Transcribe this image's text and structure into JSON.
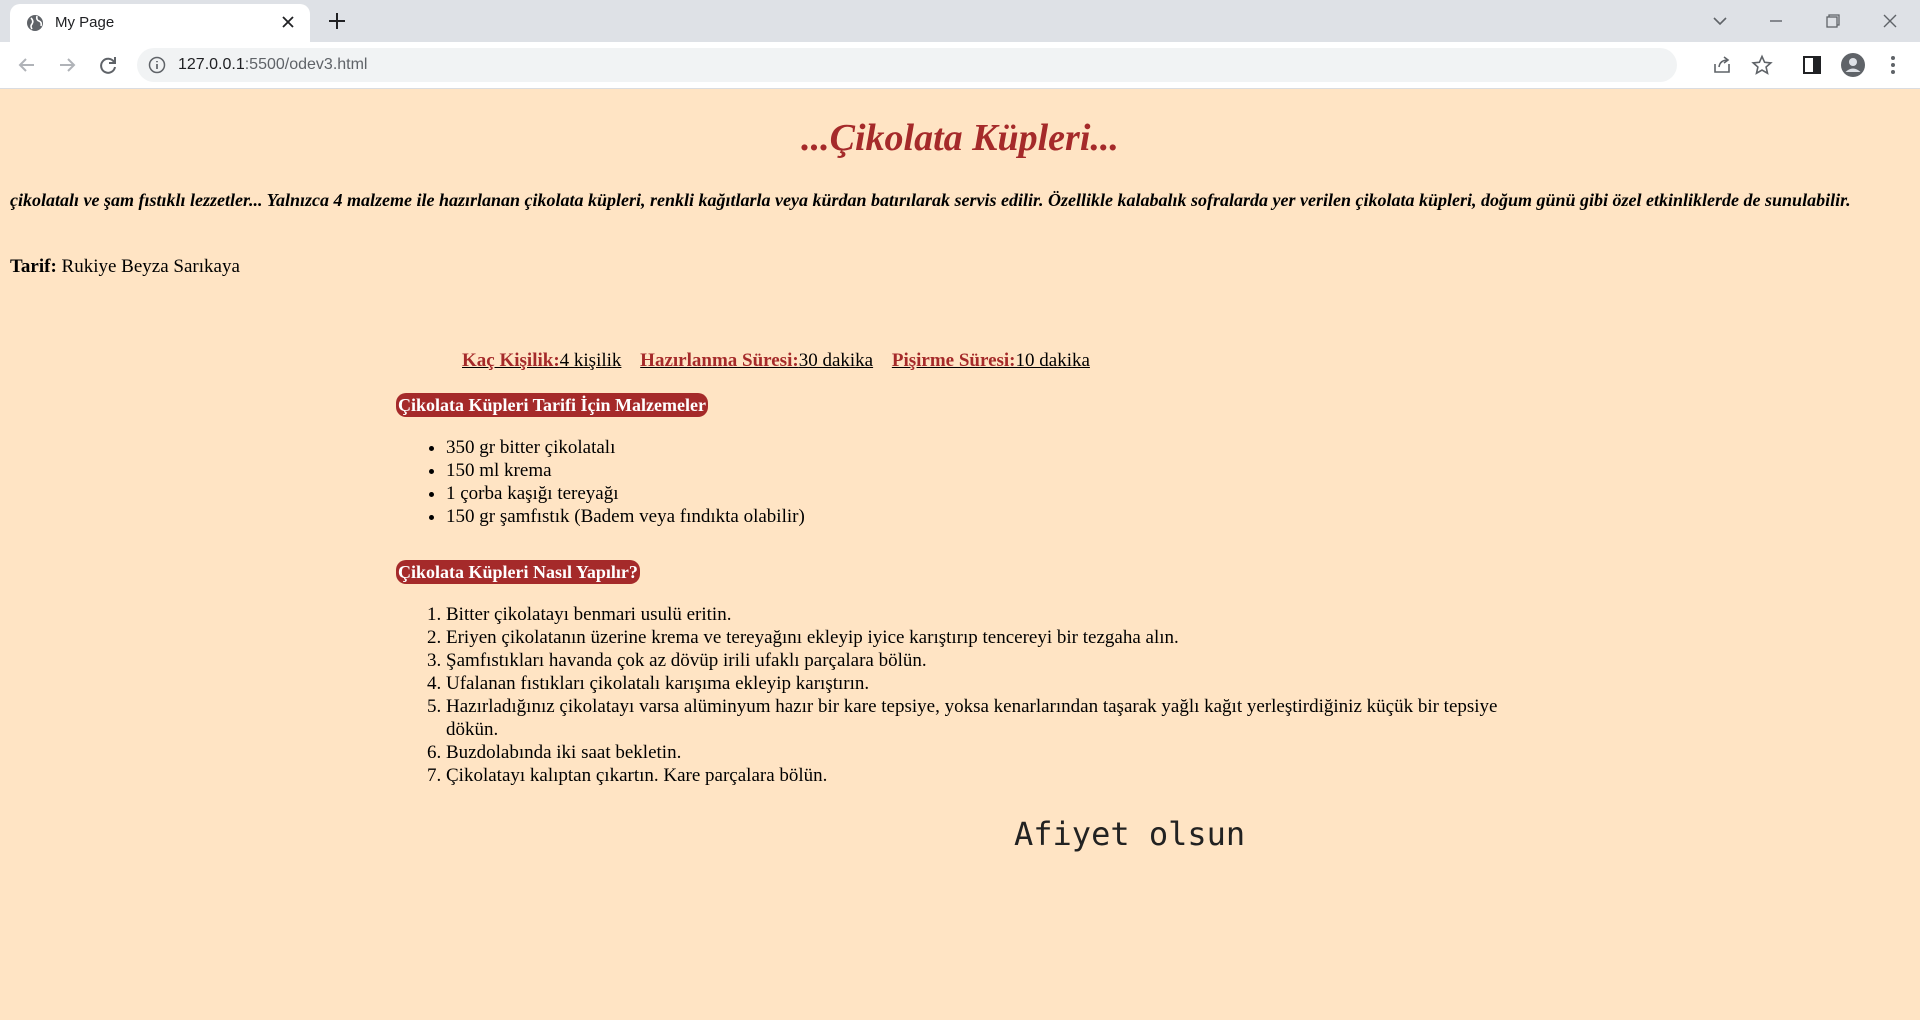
{
  "browser": {
    "tab_title": "My Page",
    "url_host": "127.0.0.1",
    "url_path": ":5500/odev3.html"
  },
  "page": {
    "title": "...Çikolata Küpleri...",
    "intro": "çikolatalı ve şam fıstıklı lezzetler... Yalnızca 4 malzeme ile hazırlanan çikolata küpleri, renkli kağıtlarla veya kürdan batırılarak servis edilir. Özellikle kalabalık sofralarda yer verilen çikolata küpleri, doğum günü gibi özel etkinliklerde de sunulabilir.",
    "author_label": "Tarif:",
    "author_name": "Rukiye Beyza Sarıkaya",
    "meta": [
      {
        "label": "Kaç Kişilik:",
        "value": "4 kişilik"
      },
      {
        "label": "Hazırlanma Süresi:",
        "value": "30 dakika"
      },
      {
        "label": "Pişirme Süresi:",
        "value": "10 dakika"
      }
    ],
    "ingredients_title": "Çikolata Küpleri Tarifi İçin Malzemeler",
    "ingredients": [
      "350 gr bitter çikolatalı",
      "150 ml krema",
      "1 çorba kaşığı tereyağı",
      "150 gr şamfıstık (Badem veya fındıkta olabilir)"
    ],
    "steps_title": "Çikolata Küpleri Nasıl Yapılır?",
    "steps": [
      "Bitter çikolatayı benmari usulü eritin.",
      "Eriyen çikolatanın üzerine krema ve tereyağını ekleyip iyice karıştırıp tencereyi bir tezgaha alın.",
      "Şamfıstıkları havanda çok az dövüp irili ufaklı parçalara bölün.",
      "Ufalanan fıstıkları çikolatalı karışıma ekleyip karıştırın.",
      "Hazırladığınız çikolatayı varsa alüminyum hazır bir kare tepsiye, yoksa kenarlarından taşarak yağlı kağıt yerleştirdiğiniz küçük bir tepsiye dökün.",
      "Buzdolabında iki saat bekletin.",
      "Çikolatayı kalıptan çıkartın. Kare parçalara bölün."
    ],
    "closing": "Afiyet olsun"
  },
  "colors": {
    "page_bg": "#ffe4c4",
    "accent": "#a52a2a",
    "chrome_bg": "#dee1e6"
  }
}
